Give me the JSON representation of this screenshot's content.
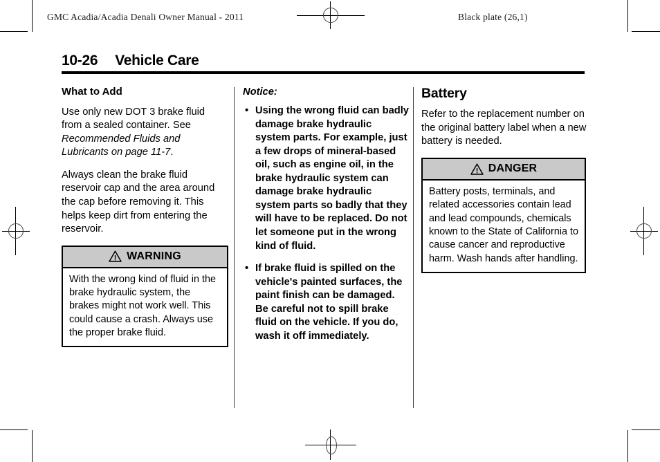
{
  "running_head": {
    "left": "GMC Acadia/Acadia Denali Owner Manual - 2011",
    "right": "Black plate (26,1)"
  },
  "page_head": {
    "folio": "10-26",
    "section": "Vehicle Care"
  },
  "columns": {
    "column_1": {
      "heading": "What to Add",
      "paragraph_1_part_1": "Use only new DOT 3 brake fluid from a sealed container. See ",
      "paragraph_1_italic": "Recommended Fluids and Lubricants on page 11-7",
      "paragraph_1_part_2": ".",
      "paragraph_2": "Always clean the brake fluid reservoir cap and the area around the cap before removing it. This helps keep dirt from entering the reservoir.",
      "warning": {
        "icon": "warning-triangle-icon",
        "title": "WARNING",
        "body": "With the wrong kind of fluid in the brake hydraulic system, the brakes might not work well. This could cause a crash. Always use the proper brake fluid."
      }
    },
    "column_2": {
      "notice_label": "Notice:",
      "bullet_marker": "•",
      "bullets": [
        "Using the wrong fluid can badly damage brake hydraulic system parts. For example, just a few drops of mineral-based oil, such as engine oil, in the brake hydraulic system can damage brake hydraulic system parts so badly that they will have to be replaced. Do not let someone put in the wrong kind of fluid.",
        "If brake fluid is spilled on the vehicle's painted surfaces, the paint finish can be damaged. Be careful not to spill brake fluid on the vehicle. If you do, wash it off immediately."
      ]
    },
    "column_3": {
      "heading": "Battery",
      "paragraph_1": "Refer to the replacement number on the original battery label when a new battery is needed.",
      "danger": {
        "icon": "warning-triangle-icon",
        "title": "DANGER",
        "body": "Battery posts, terminals, and related accessories contain lead and lead compounds, chemicals known to the State of California to cause cancer and reproductive harm. Wash hands after handling."
      }
    }
  },
  "print_marks": {
    "registration_top": "registration-target-icon",
    "registration_left": "registration-target-icon",
    "registration_right": "registration-target-icon",
    "registration_bottom": "registration-target-icon"
  },
  "colors": {
    "alert_header_gray": "#c9c9c9",
    "rule_black": "#000000",
    "page_background": "#ffffff"
  }
}
